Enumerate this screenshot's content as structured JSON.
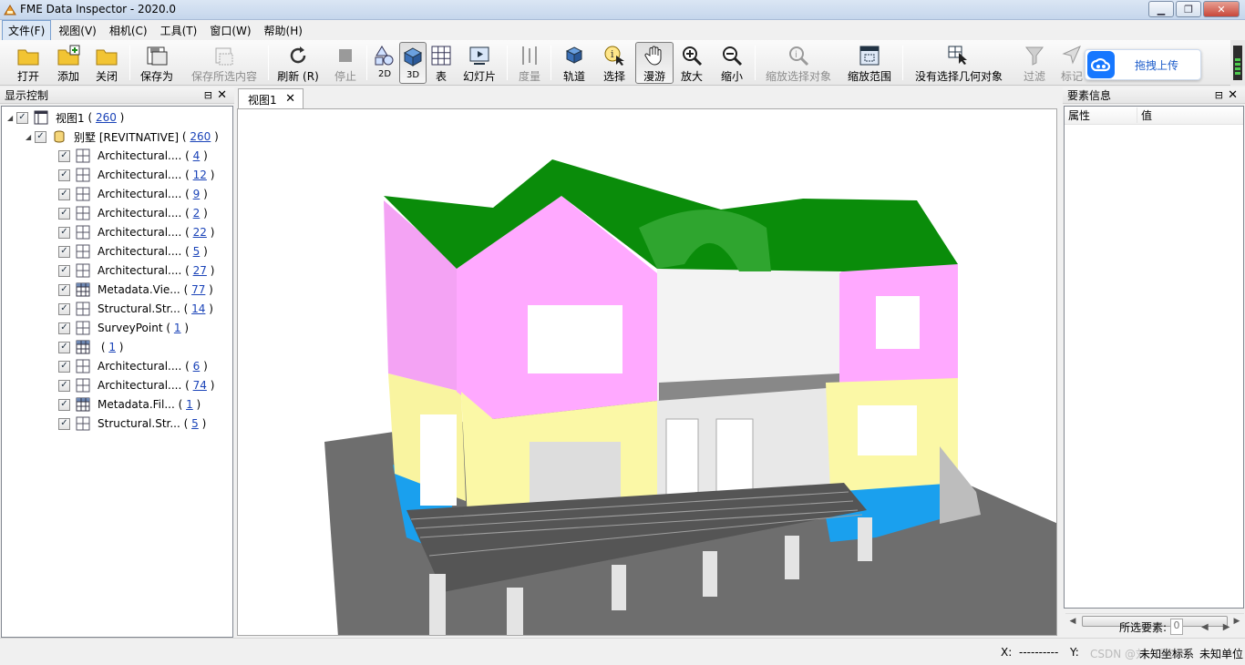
{
  "window": {
    "title": "FME Data Inspector - 2020.0"
  },
  "menu": [
    "文件(F)",
    "视图(V)",
    "相机(C)",
    "工具(T)",
    "窗口(W)",
    "帮助(H)"
  ],
  "toolbar": {
    "open": "打开",
    "add": "添加",
    "close": "关闭",
    "save_as": "保存为",
    "save_selected": "保存所选内容",
    "refresh": "刷新 (R)",
    "stop": "停止",
    "view_2d": "2D",
    "view_3d": "3D",
    "table": "表",
    "slideshow": "幻灯片",
    "measure": "度量",
    "orbit": "轨道",
    "select": "选择",
    "pan": "漫游",
    "zoom_in": "放大",
    "zoom_out": "缩小",
    "zoom_selected": "缩放选择对象",
    "zoom_extent": "缩放范围",
    "no_geometry": "没有选择几何对象",
    "filter": "过滤",
    "mark": "标记"
  },
  "cloud_upload": {
    "label": "拖拽上传",
    "brand_color": "#1677ff"
  },
  "left_panel": {
    "title": "显示控制",
    "tree": {
      "root": {
        "label": "视图1",
        "count": "260"
      },
      "dataset": {
        "label": "别墅 [REVITNATIVE]",
        "count": "260"
      },
      "layers": [
        {
          "label": "Architectural....",
          "count": "4",
          "icon": "grid-icon"
        },
        {
          "label": "Architectural....",
          "count": "12",
          "icon": "grid-icon"
        },
        {
          "label": "Architectural....",
          "count": "9",
          "icon": "grid-icon"
        },
        {
          "label": "Architectural....",
          "count": "2",
          "icon": "grid-icon"
        },
        {
          "label": "Architectural....",
          "count": "22",
          "icon": "grid-icon"
        },
        {
          "label": "Architectural....",
          "count": "5",
          "icon": "grid-icon"
        },
        {
          "label": "Architectural....",
          "count": "27",
          "icon": "grid-icon"
        },
        {
          "label": "Metadata.Vie...",
          "count": "77",
          "icon": "table-icon"
        },
        {
          "label": "Structural.Str...",
          "count": "14",
          "icon": "grid-icon"
        },
        {
          "label": "SurveyPoint",
          "count": "1",
          "icon": "grid-icon"
        },
        {
          "label": "",
          "count": "1",
          "icon": "table-icon"
        },
        {
          "label": "Architectural....",
          "count": "6",
          "icon": "grid-icon"
        },
        {
          "label": "Architectural....",
          "count": "74",
          "icon": "grid-icon"
        },
        {
          "label": "Metadata.Fil...",
          "count": "1",
          "icon": "table-icon"
        },
        {
          "label": "Structural.Str...",
          "count": "5",
          "icon": "grid-icon"
        }
      ]
    }
  },
  "view_tab": {
    "label": "视图1"
  },
  "right_panel": {
    "title": "要素信息",
    "columns": [
      "属性",
      "值"
    ],
    "selected_label": "所选要素:",
    "selected_count": "0"
  },
  "status": {
    "x_label": "X:",
    "x_value": "----------",
    "y_label": "Y:",
    "y_value": "----------",
    "coord_sys": "未知坐标系",
    "units": "未知单位",
    "watermark": "CSDN @刘一哥GIS"
  }
}
